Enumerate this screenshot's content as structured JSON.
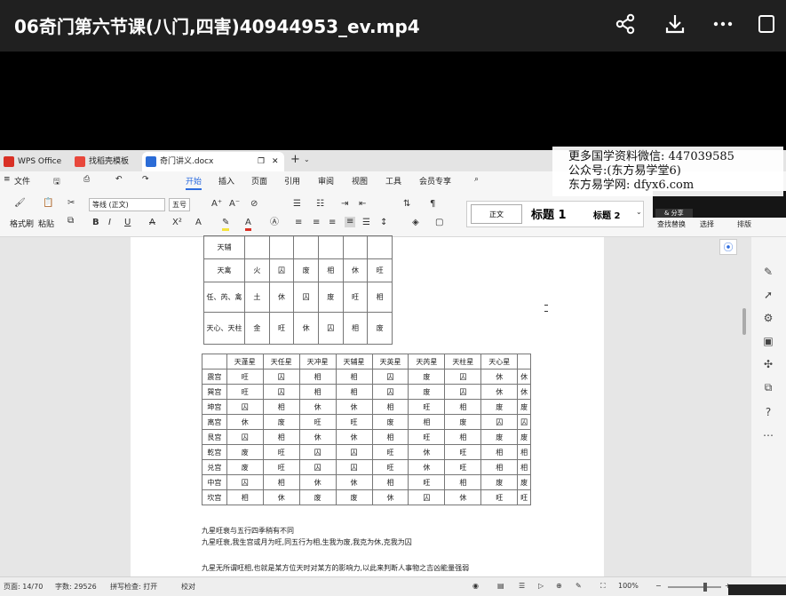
{
  "video": {
    "title": "06奇门第六节课(八门,四害)40944953_ev.mp4",
    "icons": [
      "share-icon",
      "download-icon",
      "more-icon",
      "window-icon"
    ]
  },
  "wps_tabs": [
    {
      "label": "WPS Office",
      "color": "#d93025"
    },
    {
      "label": "找稻壳模板",
      "color": "#e8473b"
    },
    {
      "label": "奇门讲义.docx",
      "color": "#2b6cd7"
    }
  ],
  "menu": {
    "file": "文件",
    "items": [
      "开始",
      "插入",
      "页面",
      "引用",
      "审阅",
      "视图",
      "工具",
      "会员专享"
    ],
    "active": "开始"
  },
  "ribbon": {
    "format_painter": "格式刷",
    "paste": "粘贴",
    "font_name": "等线 (正文)",
    "font_size": "五号",
    "styles": [
      "正文",
      "标题 1",
      "标题 2"
    ],
    "find_replace": "查找替换",
    "select": "选择",
    "arrange": "排版",
    "share_badge": "& 分享"
  },
  "watermark": {
    "line1": "更多国学资料微信: 447039585",
    "line2": "公众号:(东方易学堂6)",
    "line3": "东方易学网: dfyx6.com"
  },
  "table1": {
    "rows": [
      [
        "天辅",
        "",
        "",
        "",
        "",
        "",
        ""
      ],
      [
        "天禽",
        "火",
        "囚",
        "废",
        "相",
        "休",
        "旺"
      ],
      [
        "任、芮、禽",
        "土",
        "休",
        "囚",
        "废",
        "旺",
        "相"
      ],
      [
        "天心、天柱",
        "金",
        "旺",
        "休",
        "囚",
        "相",
        "废"
      ]
    ]
  },
  "table2": {
    "header": [
      "",
      "天蓬星",
      "天任星",
      "天冲星",
      "天辅星",
      "天英星",
      "天芮星",
      "天柱星",
      "天心星"
    ],
    "rows": [
      [
        "震宫",
        "旺",
        "囚",
        "相",
        "相",
        "囚",
        "废",
        "囚",
        "休",
        "休"
      ],
      [
        "巽宫",
        "旺",
        "囚",
        "相",
        "相",
        "囚",
        "废",
        "囚",
        "休",
        "休"
      ],
      [
        "坤宫",
        "囚",
        "相",
        "休",
        "休",
        "相",
        "旺",
        "相",
        "废",
        "废"
      ],
      [
        "离宫",
        "休",
        "废",
        "旺",
        "旺",
        "废",
        "相",
        "废",
        "囚",
        "囚"
      ],
      [
        "艮宫",
        "囚",
        "相",
        "休",
        "休",
        "相",
        "旺",
        "相",
        "废",
        "废"
      ],
      [
        "乾宫",
        "废",
        "旺",
        "囚",
        "囚",
        "旺",
        "休",
        "旺",
        "相",
        "相"
      ],
      [
        "兑宫",
        "废",
        "旺",
        "囚",
        "囚",
        "旺",
        "休",
        "旺",
        "相",
        "相"
      ],
      [
        "中宫",
        "囚",
        "相",
        "休",
        "休",
        "相",
        "旺",
        "相",
        "废",
        "废"
      ],
      [
        "坎宫",
        "相",
        "休",
        "废",
        "废",
        "休",
        "囚",
        "休",
        "旺",
        "旺"
      ]
    ]
  },
  "paragraphs": [
    "九星旺衰与五行四季稍有不同",
    "九星旺衰,我生宫或月为旺,同五行为相,生我为废,我克为休,克我为囚",
    "九星无所谓旺相,也就是某方位天时对某方的影响力,以此来判断人事物之吉凶能量强弱"
  ],
  "status": {
    "page": "页面: 14/70",
    "words": "字数: 29526",
    "spell": "拼写检查: 打开",
    "proof": "校对",
    "zoom": "100%"
  }
}
